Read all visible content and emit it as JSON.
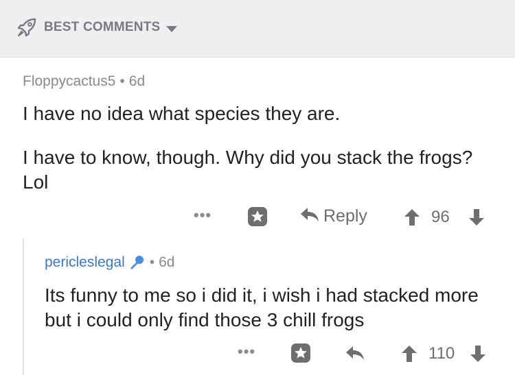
{
  "sort_bar": {
    "label": "BEST COMMENTS",
    "icon": "rocket-icon",
    "dropdown_icon": "caret-down-icon"
  },
  "comments": [
    {
      "author": "Floppycactus5",
      "separator": "•",
      "age": "6d",
      "paragraphs": [
        "I have no idea what species they are.",
        "I have to know, though. Why did you stack the frogs? Lol"
      ],
      "actions": {
        "more": "•••",
        "reply_label": "Reply"
      },
      "score": "96"
    },
    {
      "author": "pericleslegal",
      "author_badge_icon": "microphone-icon",
      "separator": "•",
      "age": "6d",
      "paragraphs": [
        "Its funny to me so i did it, i wish i had stacked more but i could only find those 3 chill frogs"
      ],
      "actions": {
        "more": "•••"
      },
      "score": "110"
    }
  ],
  "colors": {
    "header_bg": "#efeff1",
    "icon_gray": "#6e6e6e",
    "username_blue": "#3d78c4",
    "badge_blue": "#4a90e2"
  }
}
